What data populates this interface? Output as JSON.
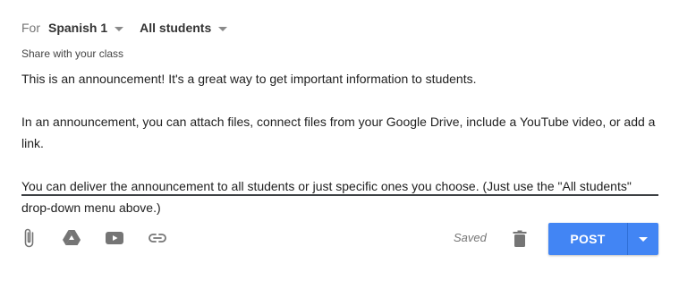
{
  "header": {
    "for_label": "For",
    "class_name": "Spanish 1",
    "audience": "All students"
  },
  "share_label": "Share with your class",
  "message": {
    "paragraphs": [
      "This is an announcement! It's a great way to get important information to students.",
      "In an announcement, you can attach files, connect files from your Google Drive, include a YouTube video, or add a link.",
      "You can deliver the announcement to all students or just specific ones you choose. (Just use the \"All students\" drop-down menu above.)"
    ]
  },
  "toolbar": {
    "icons": [
      "paperclip-icon",
      "google-drive-icon",
      "youtube-icon",
      "link-icon",
      "trash-icon"
    ],
    "status": "Saved"
  },
  "post": {
    "label": "POST",
    "color": "#4285f4"
  }
}
